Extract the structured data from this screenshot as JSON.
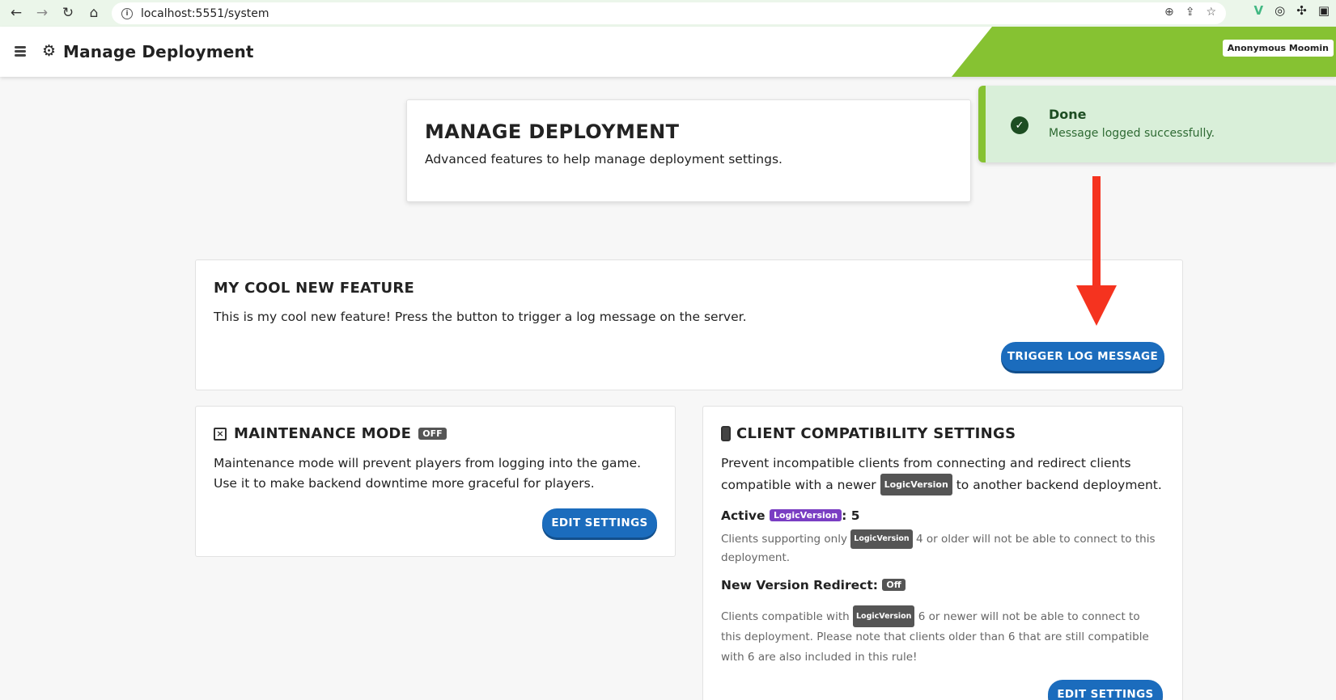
{
  "browser": {
    "url": "localhost:5551/system"
  },
  "header": {
    "title": "Manage Deployment",
    "user": "Anonymous Moomin"
  },
  "toast": {
    "title": "Done",
    "message": "Message logged successfully."
  },
  "intro": {
    "title": "MANAGE DEPLOYMENT",
    "subtitle": "Advanced features to help manage deployment settings."
  },
  "feature": {
    "title": "MY COOL NEW FEATURE",
    "description": "This is my cool new feature! Press the button to trigger a log message on the server.",
    "button": "TRIGGER LOG MESSAGE"
  },
  "maintenance": {
    "title": "MAINTENANCE MODE",
    "status": "OFF",
    "description": "Maintenance mode will prevent players from logging into the game. Use it to make backend downtime more graceful for players.",
    "button": "EDIT SETTINGS"
  },
  "compat": {
    "title": "CLIENT COMPATIBILITY SETTINGS",
    "desc_a": "Prevent incompatible clients from connecting and redirect clients compatible with a newer",
    "desc_badge": "LogicVersion",
    "desc_b": "to another backend deployment.",
    "active_label": "Active",
    "active_badge": "LogicVersion",
    "active_value": ": 5",
    "note1_a": "Clients supporting only",
    "note1_badge": "LogicVersion",
    "note1_b": "4 or older will not be able to connect to this deployment.",
    "redirect_label": "New Version Redirect:",
    "redirect_status": "Off",
    "note2_a": "Clients compatible with",
    "note2_badge": "LogicVersion",
    "note2_b": "6 or newer will not be able to connect to this deployment. Please note that clients older than 6 that are still compatible with 6 are also included in this rule!",
    "button": "EDIT SETTINGS"
  },
  "colors": {
    "accent_green": "#86c232",
    "button_blue": "#1b6cbd",
    "arrow_red": "#f5331f",
    "badge_purple": "#7a3ec3"
  }
}
